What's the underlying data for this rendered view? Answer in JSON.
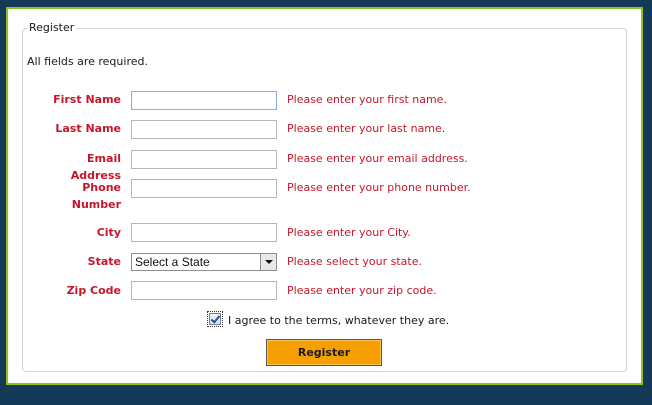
{
  "form": {
    "legend": "Register",
    "required_note": "All fields are required.",
    "fields": [
      {
        "label": "First Name",
        "value": "",
        "error": "Please enter your first name."
      },
      {
        "label": "Last Name",
        "value": "",
        "error": "Please enter your last name."
      },
      {
        "label": "Email Address",
        "value": "",
        "error": "Please enter your email address."
      },
      {
        "label_line1": "Phone",
        "label_line2": "Number",
        "value": "",
        "error": "Please enter your phone number."
      },
      {
        "label": "City",
        "value": "",
        "error": "Please enter your City."
      },
      {
        "label": "State",
        "selected": "Select a State",
        "error": "Please select your state."
      },
      {
        "label": "Zip Code",
        "value": "",
        "error": "Please enter your zip code."
      }
    ],
    "terms": {
      "checked": true,
      "label": "I agree to the terms, whatever they are."
    },
    "submit_label": "Register"
  },
  "colors": {
    "background": "#143a57",
    "frame_border": "#93c01f",
    "error_text": "#c4172b",
    "button": "#f5a000"
  }
}
